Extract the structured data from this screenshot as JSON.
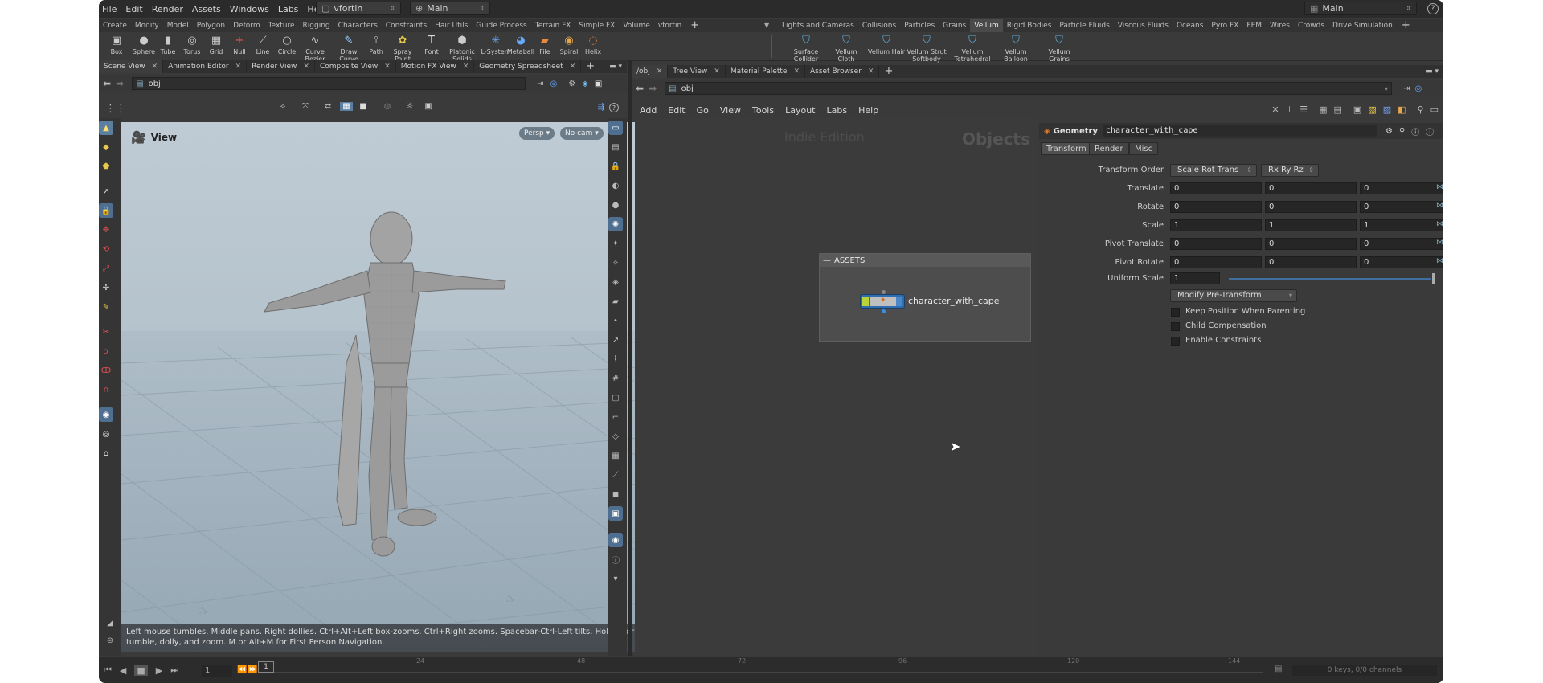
{
  "menubar": {
    "items": [
      "File",
      "Edit",
      "Render",
      "Assets",
      "Windows",
      "Labs",
      "Help"
    ],
    "desktop_combo": "vfortin",
    "scene_combo": "Main",
    "right_combo": "Main"
  },
  "shelf_tabs_left": [
    "Create",
    "Modify",
    "Model",
    "Polygon",
    "Deform",
    "Texture",
    "Rigging",
    "Characters",
    "Constraints",
    "Hair Utils",
    "Guide Process",
    "Terrain FX",
    "Simple FX",
    "Volume",
    "vfortin"
  ],
  "shelf_tabs_right": [
    "Lights and Cameras",
    "Collisions",
    "Particles",
    "Grains",
    "Vellum",
    "Rigid Bodies",
    "Particle Fluids",
    "Viscous Fluids",
    "Oceans",
    "Pyro FX",
    "FEM",
    "Wires",
    "Crowds",
    "Drive Simulation"
  ],
  "shelf_tabs_right_active": "Vellum",
  "shelf_tools_left": [
    "Box",
    "Sphere",
    "Tube",
    "Torus",
    "Grid",
    "Null",
    "Line",
    "Circle",
    "Curve Bezier",
    "Draw Curve",
    "Path",
    "Spray Paint",
    "Font",
    "Platonic Solids",
    "L-System",
    "Metaball",
    "File",
    "Spiral",
    "Helix"
  ],
  "shelf_tools_right": [
    "Surface Collider",
    "Vellum Cloth",
    "Vellum Hair",
    "Vellum Strut Softbody",
    "Vellum Tetrahedral ...",
    "Vellum Balloon",
    "Vellum Grains"
  ],
  "left_pane_tabs": [
    "Scene View",
    "Animation Editor",
    "Render View",
    "Composite View",
    "Motion FX View",
    "Geometry Spreadsheet"
  ],
  "left_path": "obj",
  "viewport": {
    "title": "View",
    "persp_button": "Persp",
    "cam_button": "No cam",
    "hint": "Left mouse tumbles. Middle pans. Right dollies. Ctrl+Alt+Left box-zooms. Ctrl+Right zooms. Spacebar-Ctrl-Left tilts. Hold L for alternate tumble, dolly, and zoom. M or Alt+M for First Person Navigation."
  },
  "right_pane_tabs": [
    "/obj",
    "Tree View",
    "Material Palette",
    "Asset Browser"
  ],
  "right_path": "obj",
  "network_menu": [
    "Add",
    "Edit",
    "Go",
    "View",
    "Tools",
    "Layout",
    "Labs",
    "Help"
  ],
  "network": {
    "watermark_edition": "Indie Edition",
    "watermark_context": "Objects",
    "box_title": "ASSETS",
    "node_name": "character_with_cape"
  },
  "params": {
    "node_type": "Geometry",
    "node_name": "character_with_cape",
    "tabs": [
      "Transform",
      "Render",
      "Misc"
    ],
    "transform_order_label": "Transform Order",
    "transform_order": "Scale Rot Trans",
    "rotate_order": "Rx Ry Rz",
    "rows": [
      {
        "label": "Translate",
        "values": [
          "0",
          "0",
          "0"
        ]
      },
      {
        "label": "Rotate",
        "values": [
          "0",
          "0",
          "0"
        ]
      },
      {
        "label": "Scale",
        "values": [
          "1",
          "1",
          "1"
        ]
      },
      {
        "label": "Pivot Translate",
        "values": [
          "0",
          "0",
          "0"
        ]
      },
      {
        "label": "Pivot Rotate",
        "values": [
          "0",
          "0",
          "0"
        ]
      }
    ],
    "uniform_scale_label": "Uniform Scale",
    "uniform_scale": "1",
    "pre_transform": "Modify Pre-Transform",
    "checkboxes": [
      "Keep Position When Parenting",
      "Child Compensation",
      "Enable Constraints"
    ]
  },
  "timeline": {
    "frame": "1",
    "marker": "1",
    "ticks": [
      "24",
      "48",
      "72",
      "96",
      "120",
      "144"
    ],
    "status": "0 keys, 0/0 channels"
  }
}
